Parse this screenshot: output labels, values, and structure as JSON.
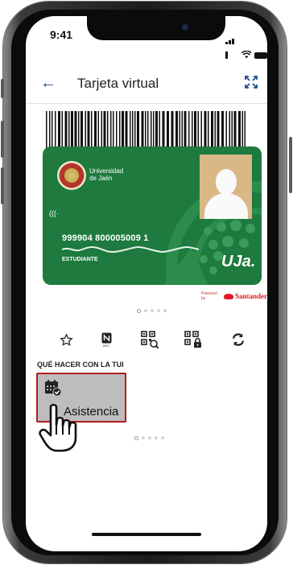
{
  "status": {
    "time": "9:41"
  },
  "appbar": {
    "title": "Tarjeta virtual"
  },
  "card": {
    "university": "Universidad de Jaén",
    "university_line1": "Universidad",
    "university_line2": "de Jaén",
    "number": "999904 800005009 1",
    "role": "ESTUDIANTE",
    "logo": "UJa."
  },
  "powered": {
    "prefix": "Powered by",
    "brand": "Santander"
  },
  "actions": [
    {
      "icon": "star-icon"
    },
    {
      "icon": "nfc-icon",
      "label": "NFC"
    },
    {
      "icon": "qr-scan-icon"
    },
    {
      "icon": "qr-lock-icon"
    },
    {
      "icon": "refresh-icon"
    }
  ],
  "section": {
    "title": "QUÉ HACER CON LA TUI"
  },
  "tile": {
    "label": "Asistencia",
    "icon": "calendar-check-icon"
  },
  "colors": {
    "card_green": "#1e7a3e",
    "accent_blue": "#1d4e8f",
    "tile_border": "#b01e1e",
    "santander_red": "#e31b23"
  }
}
